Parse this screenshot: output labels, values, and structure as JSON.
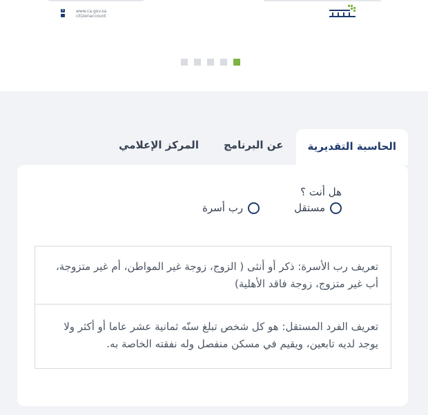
{
  "header": {
    "logo_text": "حساب المواطن",
    "site_url": "www.ca.gov.sa",
    "social_handle": "citizenaccount"
  },
  "carousel": {
    "slide_count": 5,
    "active_index": 4
  },
  "tabs": [
    {
      "label": "الحاسبة التقديرية",
      "active": true
    },
    {
      "label": "عن البرنامج",
      "active": false
    },
    {
      "label": "المركز الإعلامي",
      "active": false
    }
  ],
  "calculator": {
    "question": "هل أنت ؟",
    "options": [
      {
        "label": "مستقل",
        "checked": false
      },
      {
        "label": "رب أسرة",
        "checked": false
      }
    ],
    "definitions": [
      {
        "text": "تعريف رب الأسرة: ذكر أو أنثى ( الزوج، زوجة غير المواطن، أم غير متزوجة، أب غير متزوج، زوجة فاقد الأهلية)"
      },
      {
        "text": "تعريف الفرد المستقل: هو كل شخص تبلغ سنّه ثمانية عشر عاما أو أكثر ولا يوجد لديه تابعين، ويقيم في مسكن منفصل وله نفقته الخاصة به."
      }
    ]
  },
  "colors": {
    "brand_navy": "#1f3b6e",
    "brand_green": "#7cb342",
    "page_background": "#f1f3f6"
  }
}
